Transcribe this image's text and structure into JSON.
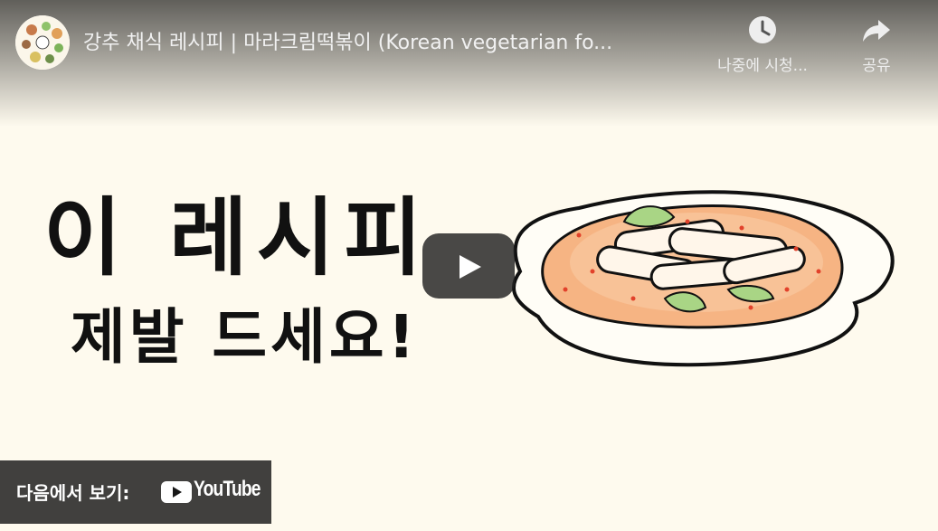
{
  "video": {
    "title": "강추 채식 레시피 | 마라크림떡볶이 (Korean vegetarian fo...",
    "channel_avatar_icon": "channel-avatar-illustration"
  },
  "actions": {
    "watch_later_label": "나중에 시청...",
    "share_label": "공유"
  },
  "thumbnail": {
    "line1": "이 레시피",
    "line2": "제발 드세요!"
  },
  "footer": {
    "watch_on_label": "다음에서 보기:",
    "brand": "YouTube"
  },
  "colors": {
    "background": "#fefaee",
    "youtube_red": "#ff0000",
    "sauce_orange": "#f6b483"
  }
}
